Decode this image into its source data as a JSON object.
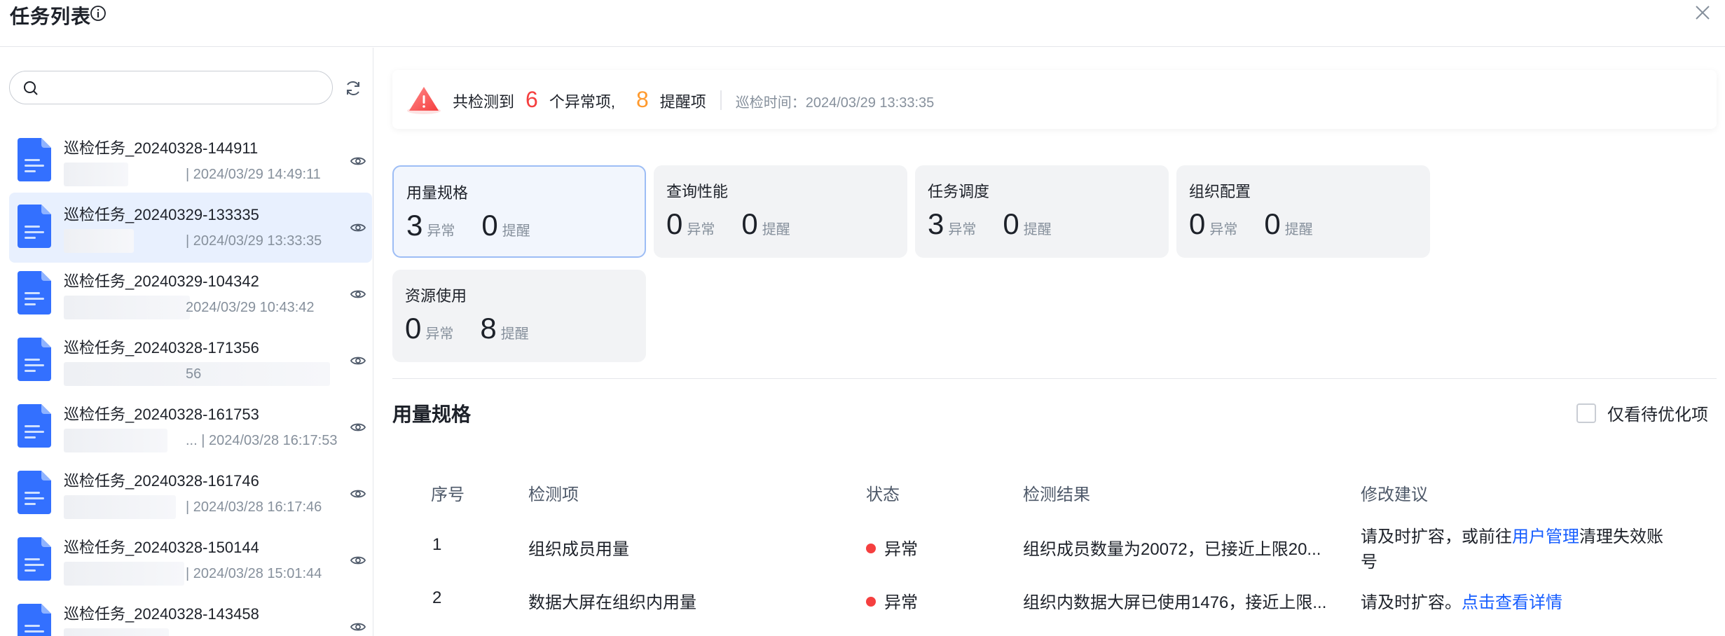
{
  "header": {
    "title": "任务列表"
  },
  "search": {
    "placeholder": ""
  },
  "tasks": [
    {
      "name": "巡检任务_20240328-144911",
      "time": "| 2024/03/29 14:49:11",
      "selected": false
    },
    {
      "name": "巡检任务_20240329-133335",
      "time": "| 2024/03/29 13:33:35",
      "selected": true
    },
    {
      "name": "巡检任务_20240329-104342",
      "time": "2024/03/29 10:43:42",
      "selected": false
    },
    {
      "name": "巡检任务_20240328-171356",
      "time": "56",
      "selected": false
    },
    {
      "name": "巡检任务_20240328-161753",
      "time": "... | 2024/03/28 16:17:53",
      "selected": false
    },
    {
      "name": "巡检任务_20240328-161746",
      "time": "| 2024/03/28 16:17:46",
      "selected": false
    },
    {
      "name": "巡检任务_20240328-150144",
      "time": "| 2024/03/28 15:01:44",
      "selected": false
    },
    {
      "name": "巡检任务_20240328-143458",
      "time": "",
      "selected": false
    }
  ],
  "summary": {
    "prefix": "共检测到",
    "abnormal_count": "6",
    "abnormal_label": "个异常项,",
    "reminder_count": "8",
    "reminder_label": "提醒项",
    "time_label": "巡检时间：2024/03/29 13:33:35"
  },
  "cards": [
    {
      "title": "用量规格",
      "abnormal": "3",
      "abnormal_label": "异常",
      "reminder": "0",
      "reminder_label": "提醒"
    },
    {
      "title": "查询性能",
      "abnormal": "0",
      "abnormal_label": "异常",
      "reminder": "0",
      "reminder_label": "提醒"
    },
    {
      "title": "任务调度",
      "abnormal": "3",
      "abnormal_label": "异常",
      "reminder": "0",
      "reminder_label": "提醒"
    },
    {
      "title": "组织配置",
      "abnormal": "0",
      "abnormal_label": "异常",
      "reminder": "0",
      "reminder_label": "提醒"
    },
    {
      "title": "资源使用",
      "abnormal": "0",
      "abnormal_label": "异常",
      "reminder": "8",
      "reminder_label": "提醒"
    }
  ],
  "section": {
    "title": "用量规格",
    "only_optimize_label": "仅看待优化项"
  },
  "table": {
    "headers": [
      "序号",
      "检测项",
      "状态",
      "检测结果",
      "修改建议"
    ],
    "rows": [
      {
        "index": "1",
        "item": "组织成员用量",
        "status": "异常",
        "result": "组织成员数量为20072，已接近上限20...",
        "suggest_pre": "请及时扩容，或前往",
        "suggest_link": "用户管理",
        "suggest_post": "清理失效账",
        "suggest_wrap": "号"
      },
      {
        "index": "2",
        "item": "数据大屏在组织内用量",
        "status": "异常",
        "result": "组织内数据大屏已使用1476，接近上限...",
        "suggest_pre": "请及时扩容。",
        "suggest_link": "点击查看详情",
        "suggest_post": "",
        "suggest_wrap": ""
      }
    ]
  },
  "colors": {
    "accent": "#165dff",
    "danger": "#f53f3f",
    "warning": "#ff9a2e",
    "doc_blue": "#3370ff"
  }
}
